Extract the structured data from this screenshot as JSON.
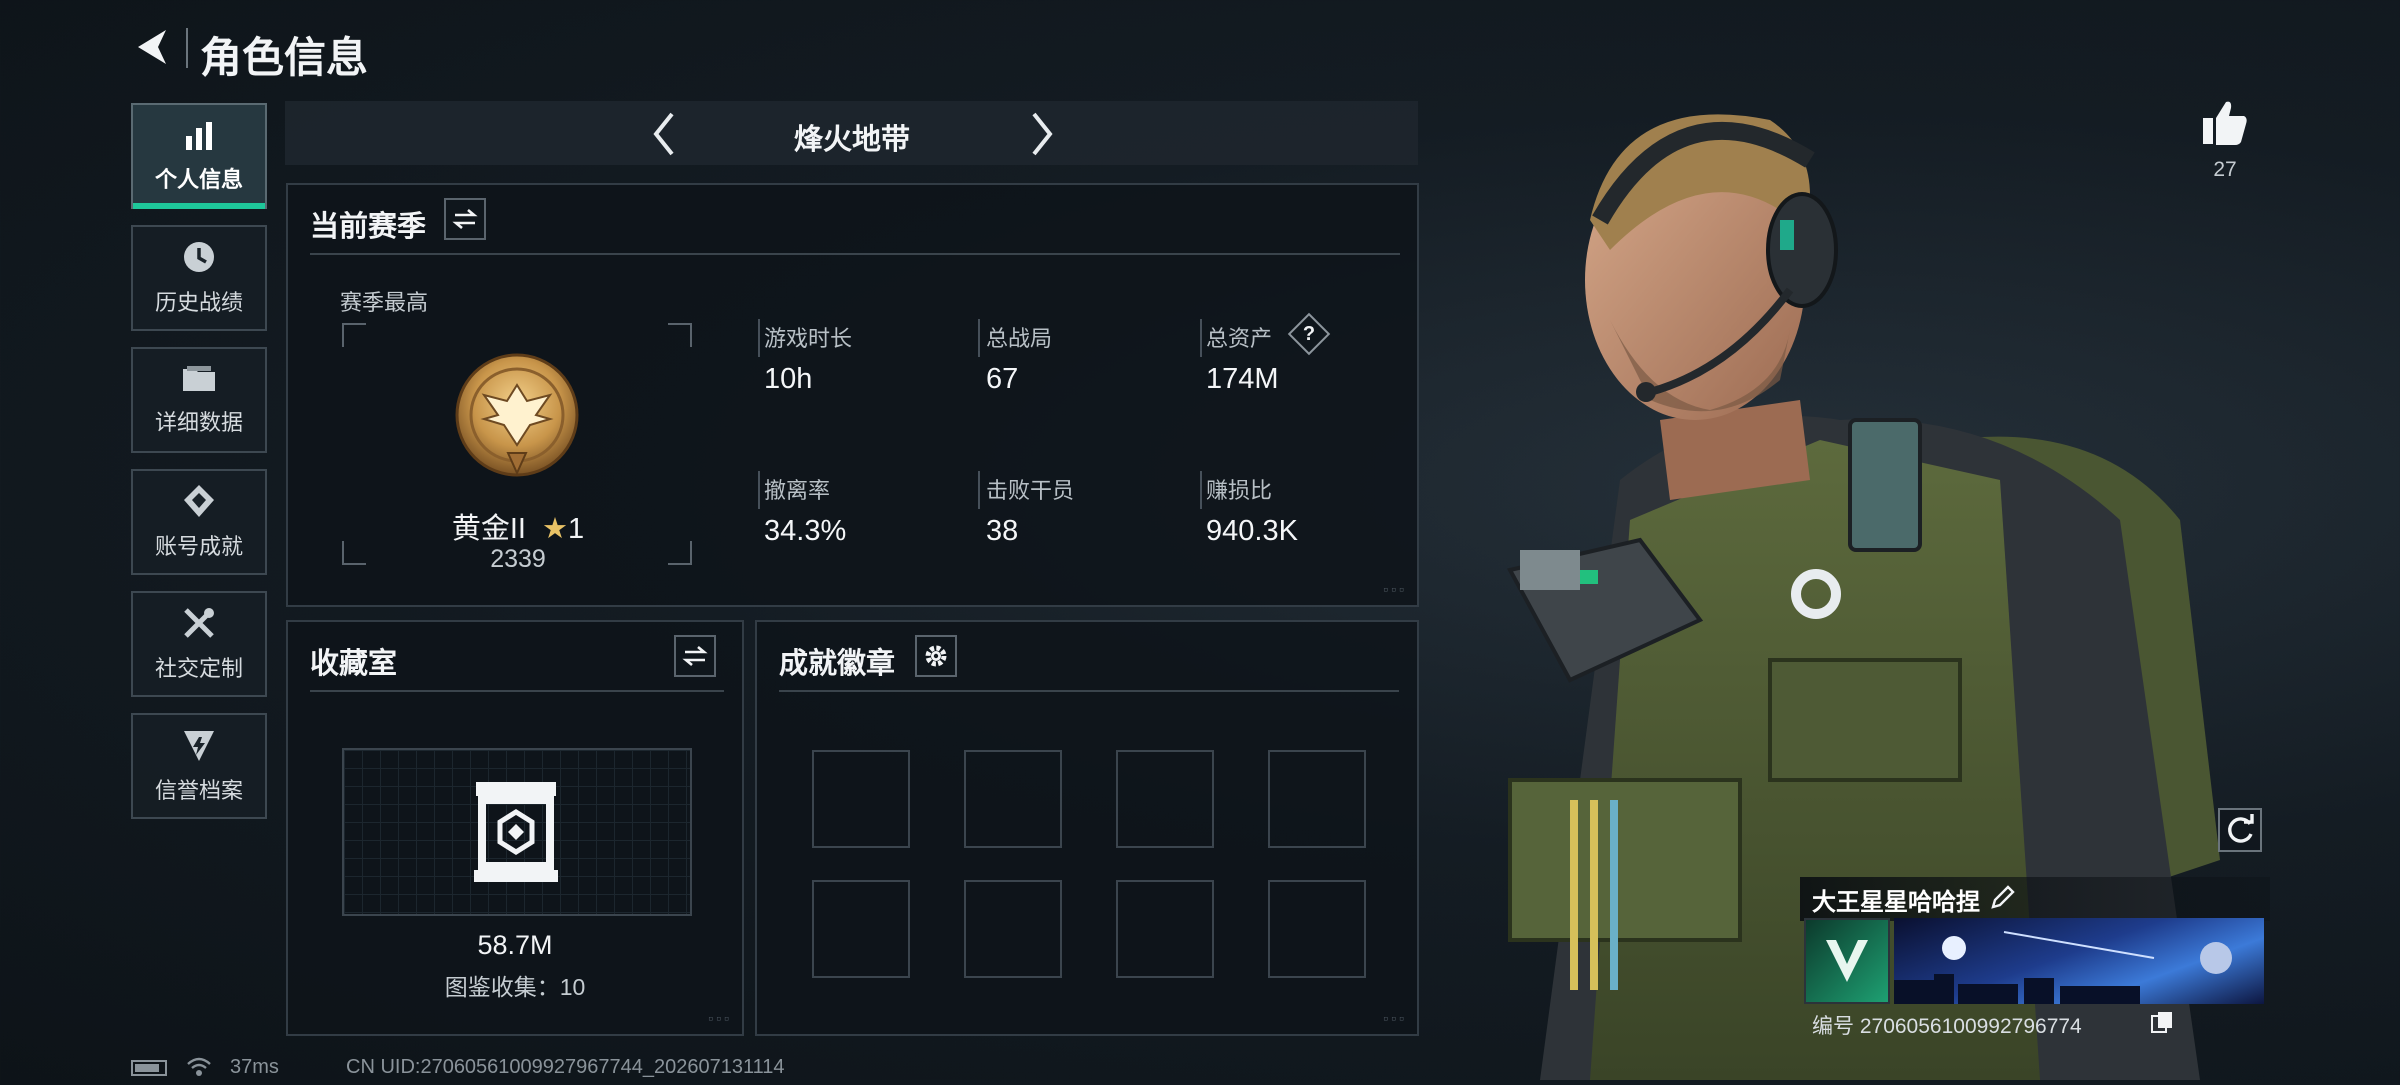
{
  "header": {
    "title": "角色信息"
  },
  "sidebar": {
    "items": [
      {
        "label": "个人信息",
        "icon": "bar-chart-icon",
        "active": true
      },
      {
        "label": "历史战绩",
        "icon": "clock-icon"
      },
      {
        "label": "详细数据",
        "icon": "folder-icon"
      },
      {
        "label": "账号成就",
        "icon": "medal-icon"
      },
      {
        "label": "社交定制",
        "icon": "tools-icon"
      },
      {
        "label": "信誉档案",
        "icon": "shield-icon"
      }
    ]
  },
  "mode_selector": {
    "label": "烽火地带"
  },
  "season": {
    "title": "当前赛季",
    "best_label": "赛季最高",
    "rank_name": "黄金II",
    "rank_stars": "1",
    "rank_score": "2339",
    "stats": [
      {
        "label": "游戏时长",
        "value": "10h"
      },
      {
        "label": "总战局",
        "value": "67"
      },
      {
        "label": "总资产",
        "value": "174M",
        "help": "?"
      },
      {
        "label": "撤离率",
        "value": "34.3%"
      },
      {
        "label": "击败干员",
        "value": "38"
      },
      {
        "label": "赚损比",
        "value": "940.3K"
      }
    ]
  },
  "collection": {
    "title": "收藏室",
    "value": "58.7M",
    "count_text": "图鉴收集：10"
  },
  "achievements": {
    "title": "成就徽章",
    "slots": 8
  },
  "likes": {
    "count": "27"
  },
  "profile": {
    "name": "大王星星哈哈捏",
    "id_text": "编号 2706056100992796774"
  },
  "status_bar": {
    "ping": "37ms",
    "uid_text": "CN UID:270605610099279677​44_202607131114"
  },
  "colors": {
    "accent": "#1ec79a",
    "panel_border": "#323c45",
    "gold": "#c8954a"
  }
}
